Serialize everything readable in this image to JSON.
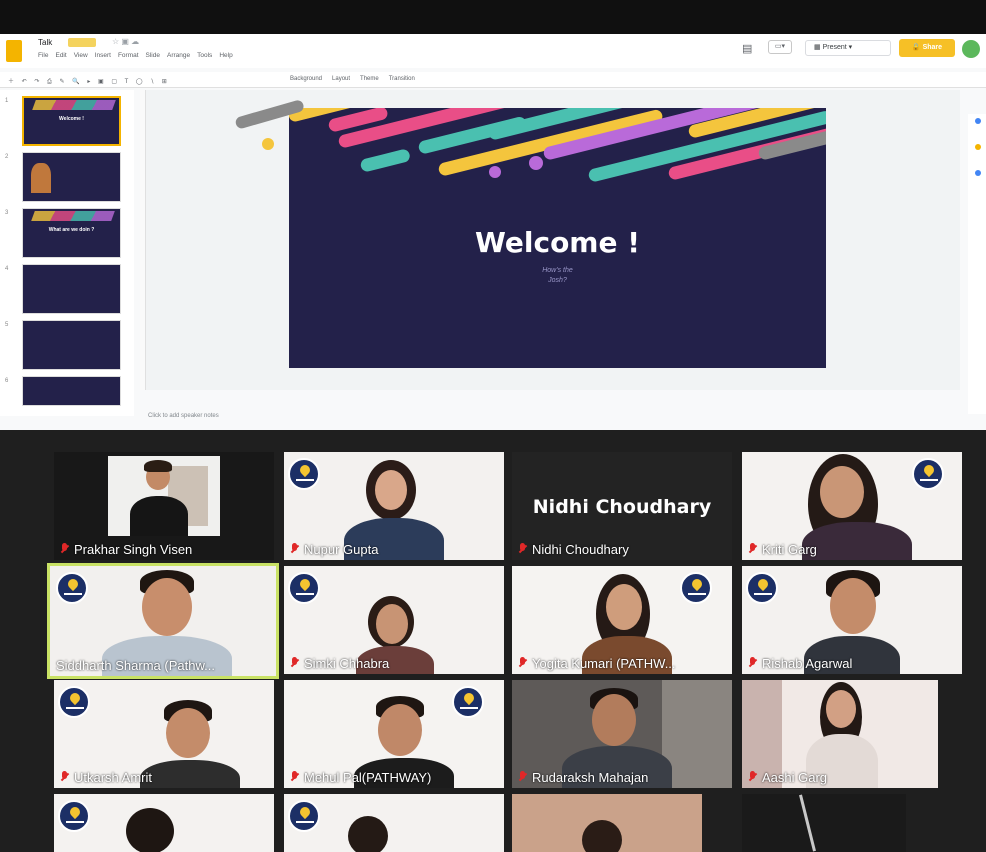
{
  "slides_app": {
    "doc_title": "Talk",
    "doc_chip": "",
    "menu": [
      "File",
      "Edit",
      "View",
      "Insert",
      "Format",
      "Slide",
      "Arrange",
      "Tools",
      "Help"
    ],
    "last_edit": "",
    "present_label": "Present",
    "share_label": "Share",
    "toolbar_items": [
      "Background",
      "Layout",
      "Theme",
      "Transition"
    ],
    "speaker_notes_placeholder": "Click to add speaker notes",
    "thumbnails": [
      {
        "num": "1",
        "text": "Welcome !"
      },
      {
        "num": "2",
        "text": ""
      },
      {
        "num": "3",
        "text": "What are we doin ?"
      },
      {
        "num": "4",
        "text": ""
      },
      {
        "num": "5",
        "text": ""
      },
      {
        "num": "6",
        "text": ""
      }
    ],
    "slide": {
      "title": "Welcome !",
      "subtitle_line1": "How's the",
      "subtitle_line2": "Josh?"
    },
    "colors": {
      "slide_bg": "#23214a",
      "yellow": "#f4c53d",
      "pink": "#e94e87",
      "teal": "#4ac0b0",
      "purple": "#b96ad9",
      "gray": "#8a8a8a"
    }
  },
  "participants": [
    {
      "name": "Prakhar Singh Visen",
      "muted": true
    },
    {
      "name": "Nupur Gupta",
      "muted": true
    },
    {
      "name": "Nidhi Choudhary",
      "muted": true,
      "display_name": "Nidhi Choudhary"
    },
    {
      "name": "Kriti Garg",
      "muted": true
    },
    {
      "name": "Siddharth Sharma (Pathw...",
      "muted": false,
      "active_speaker": true
    },
    {
      "name": "Simki Chhabra",
      "muted": true
    },
    {
      "name": "Yogita Kumari (PATHW...",
      "muted": true
    },
    {
      "name": "Rishab Agarwal",
      "muted": true
    },
    {
      "name": "Utkarsh Amrit",
      "muted": true
    },
    {
      "name": "Mehul Pal(PATHWAY)",
      "muted": true
    },
    {
      "name": "Rudaraksh Mahajan",
      "muted": true
    },
    {
      "name": "Aashi Garg",
      "muted": true
    },
    {
      "name": "",
      "muted": false
    },
    {
      "name": "",
      "muted": false
    },
    {
      "name": "",
      "muted": false
    },
    {
      "name": "",
      "muted": false
    }
  ]
}
